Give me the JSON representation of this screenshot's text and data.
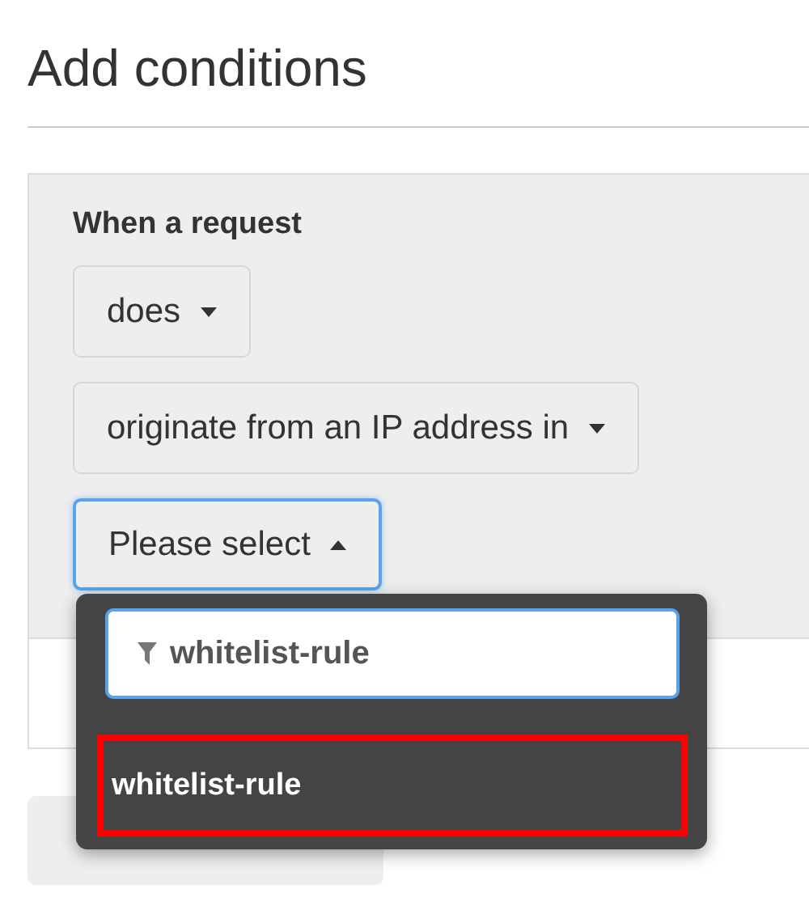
{
  "heading": "Add conditions",
  "condition": {
    "label": "When a request",
    "selects": [
      {
        "value": "does",
        "open": false
      },
      {
        "value": "originate from an IP address in",
        "open": false
      },
      {
        "value": "Please select",
        "open": true
      }
    ]
  },
  "dropdown": {
    "filter": {
      "value": "whitelist-rule"
    },
    "options": [
      {
        "label": "whitelist-rule",
        "highlighted": true
      }
    ]
  }
}
